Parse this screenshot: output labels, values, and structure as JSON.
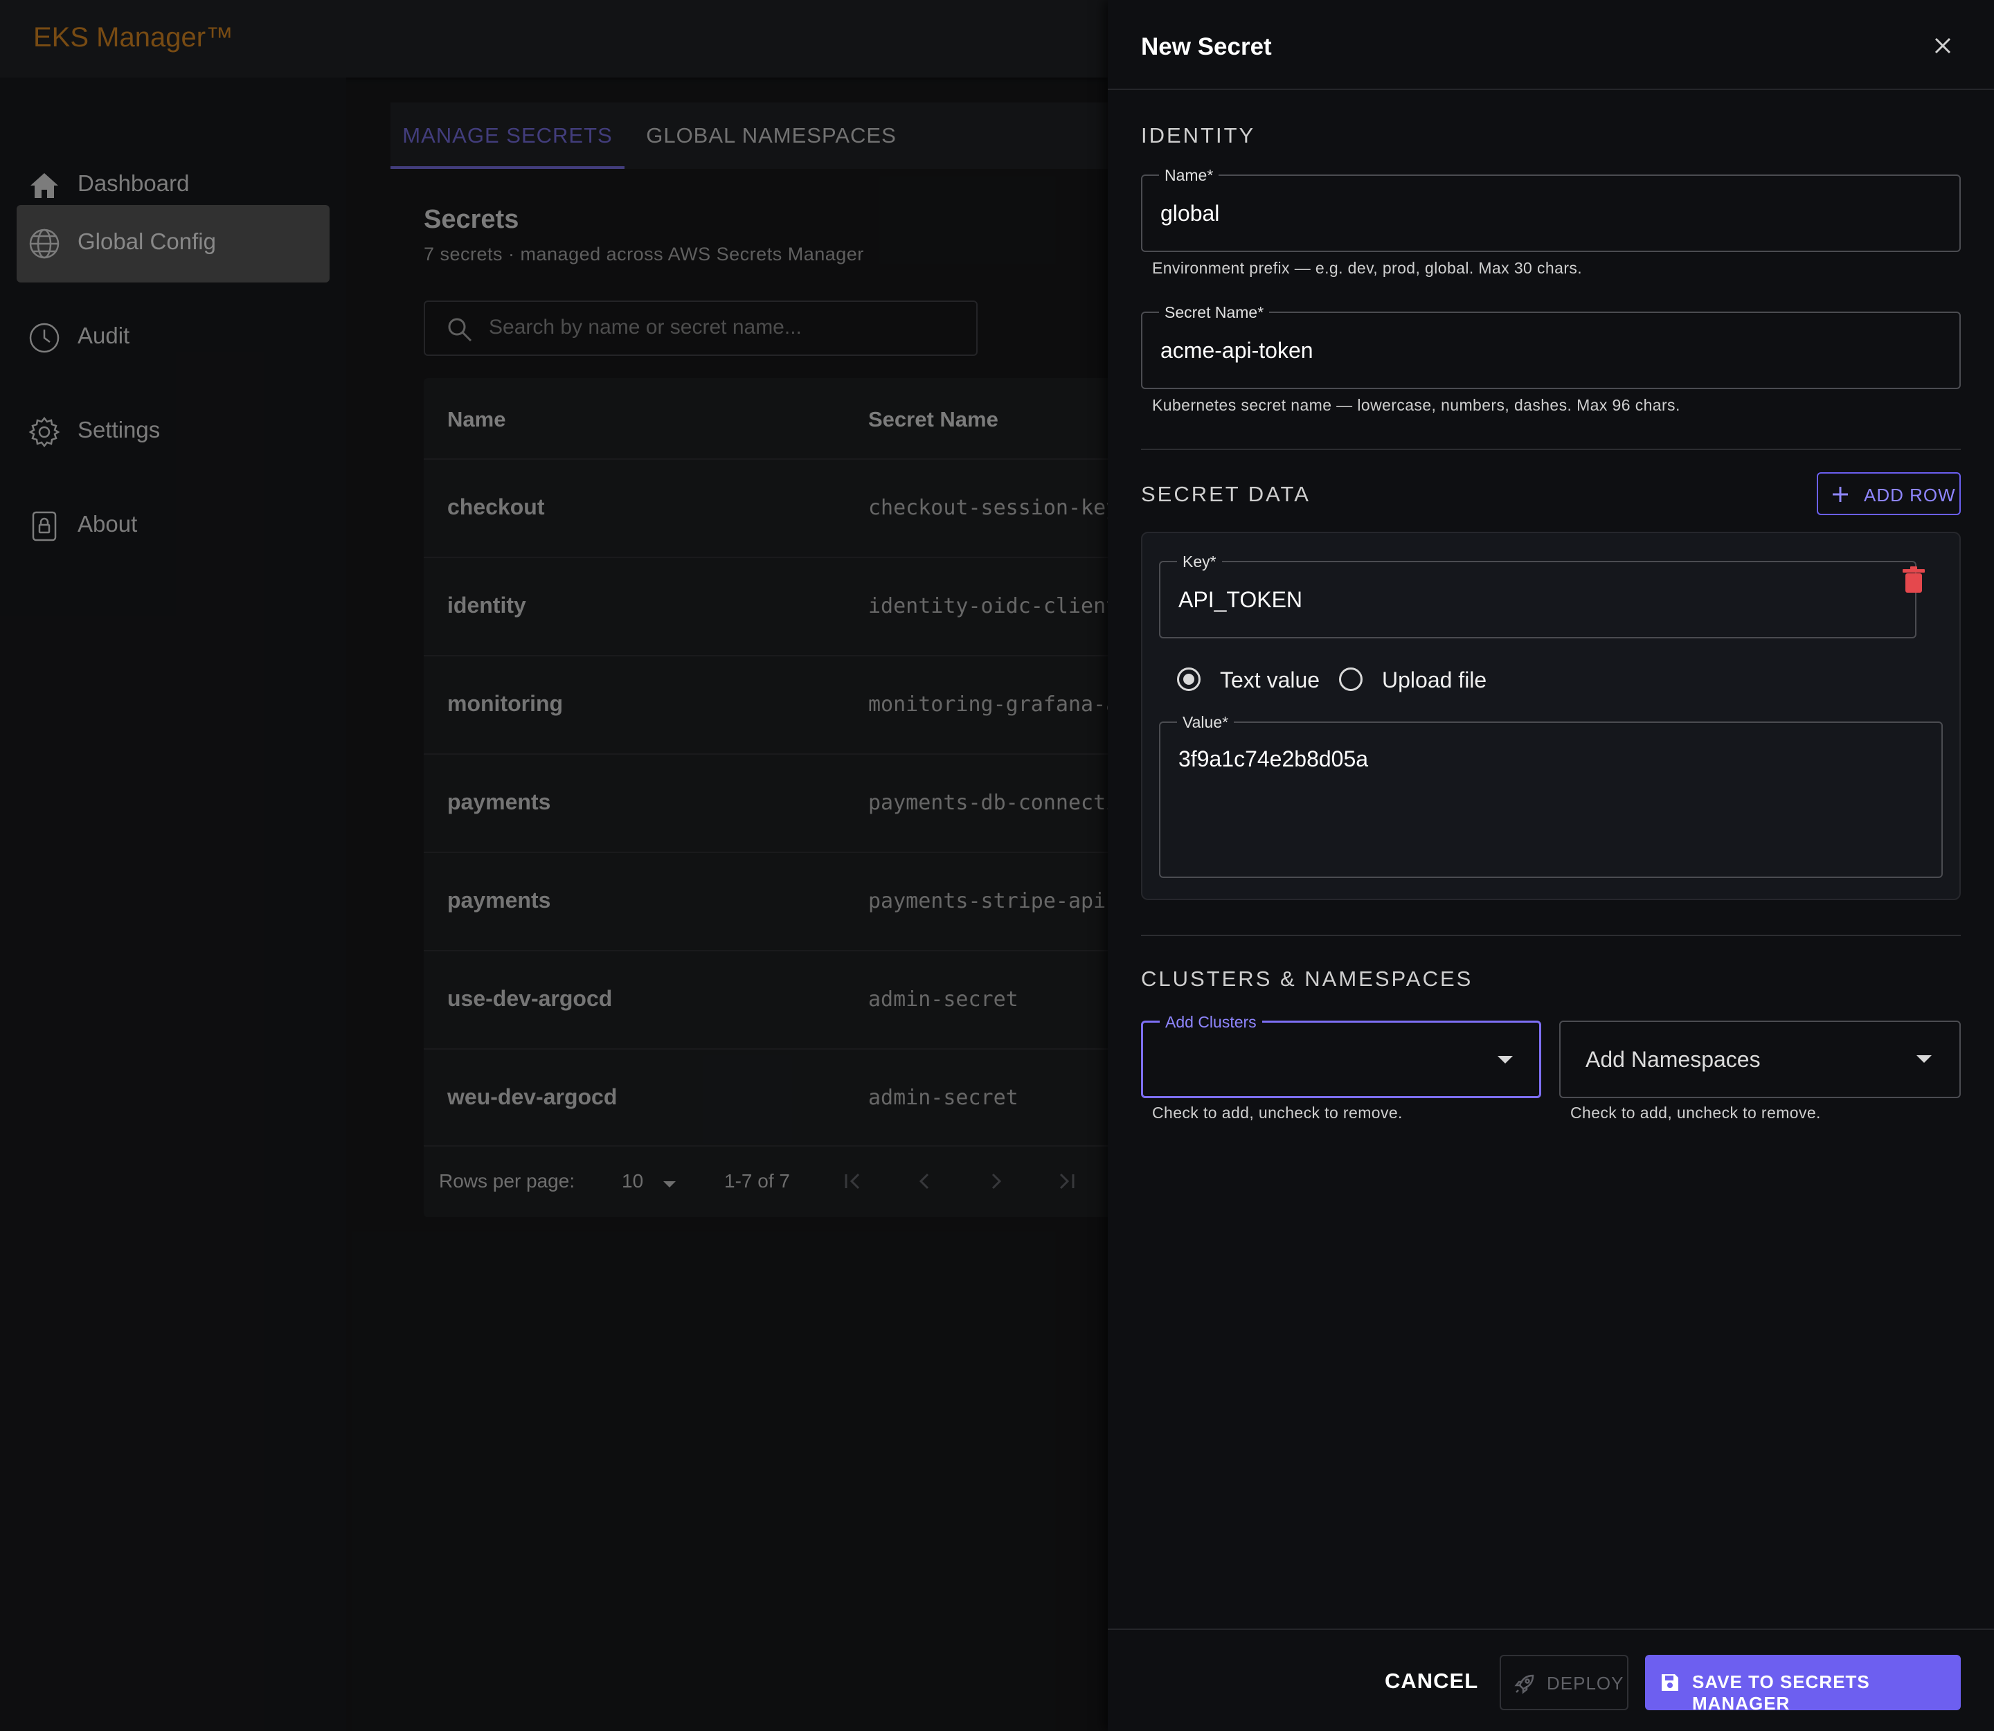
{
  "app": {
    "brand": "EKS Manager™"
  },
  "sidebar": {
    "items": [
      {
        "label": "Dashboard",
        "icon": "home-icon"
      },
      {
        "label": "Global Config",
        "icon": "globe-icon",
        "active": true
      },
      {
        "label": "Audit",
        "icon": "clock-icon"
      },
      {
        "label": "Settings",
        "icon": "gear-icon"
      },
      {
        "label": "About",
        "icon": "lock-icon"
      }
    ]
  },
  "tabs": [
    {
      "label": "MANAGE SECRETS",
      "active": true
    },
    {
      "label": "GLOBAL NAMESPACES",
      "active": false
    }
  ],
  "secrets": {
    "title": "Secrets",
    "subtitle": "7 secrets · managed across AWS Secrets Manager",
    "search_placeholder": "Search by name or secret name...",
    "columns": [
      "Name",
      "Secret Name"
    ],
    "rows": [
      {
        "name": "checkout",
        "secret": "checkout-session-key"
      },
      {
        "name": "identity",
        "secret": "identity-oidc-client"
      },
      {
        "name": "monitoring",
        "secret": "monitoring-grafana-admin"
      },
      {
        "name": "payments",
        "secret": "payments-db-connection"
      },
      {
        "name": "payments",
        "secret": "payments-stripe-api"
      },
      {
        "name": "use-dev-argocd",
        "secret": "admin-secret"
      },
      {
        "name": "weu-dev-argocd",
        "secret": "admin-secret"
      }
    ],
    "pagination": {
      "rows_per_page_label": "Rows per page:",
      "rows_per_page": "10",
      "range": "1-7 of 7"
    }
  },
  "drawer": {
    "title": "New Secret",
    "identity": {
      "section_title": "IDENTITY",
      "name_label": "Name*",
      "name_value": "global",
      "name_helper": "Environment prefix — e.g. dev, prod, global. Max 30 chars.",
      "secret_name_label": "Secret Name*",
      "secret_name_value": "acme-api-token",
      "secret_name_helper": "Kubernetes secret name — lowercase, numbers, dashes. Max 96 chars."
    },
    "secret_data": {
      "section_title": "SECRET DATA",
      "add_row_label": "ADD ROW",
      "key_label": "Key*",
      "key_value": "API_TOKEN",
      "radio_text": "Text value",
      "radio_file": "Upload file",
      "selected_mode": "Text value",
      "value_label": "Value*",
      "value_value": "3f9a1c74e2b8d05a"
    },
    "clusters": {
      "section_title": "CLUSTERS & NAMESPACES",
      "clusters_label": "Add Clusters",
      "clusters_helper": "Check to add, uncheck to remove.",
      "namespaces_placeholder": "Add Namespaces",
      "namespaces_helper": "Check to add, uncheck to remove."
    },
    "footer": {
      "cancel": "CANCEL",
      "deploy": "DEPLOY",
      "save": "SAVE TO SECRETS MANAGER"
    }
  },
  "colors": {
    "brand": "#c27a1f",
    "accent": "#6d5ff0",
    "active_tab": "#6b63c9",
    "danger": "#e5484d"
  }
}
